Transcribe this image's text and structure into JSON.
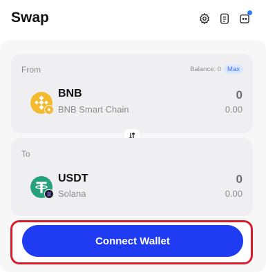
{
  "header": {
    "title": "Swap",
    "icons": [
      "gear-icon",
      "document-icon",
      "wallet-icon"
    ],
    "notification_dot_color": "#2f7cf6"
  },
  "from": {
    "label": "From",
    "balance_label": "Balance: 0",
    "max_label": "Max",
    "token": {
      "symbol": "BNB",
      "chain": "BNB Smart Chain",
      "amount": "0",
      "usd_value": "0.00",
      "icon_color": "#f3ba2f"
    }
  },
  "to": {
    "label": "To",
    "token": {
      "symbol": "USDT",
      "chain": "Solana",
      "amount": "0",
      "usd_value": "0.00",
      "icon_color": "#26a17b"
    }
  },
  "swap_toggle_icon": "swap-arrows-icon",
  "action": {
    "label": "Connect Wallet",
    "color": "#1f3cf3",
    "highlight_color": "#d61e2a"
  }
}
